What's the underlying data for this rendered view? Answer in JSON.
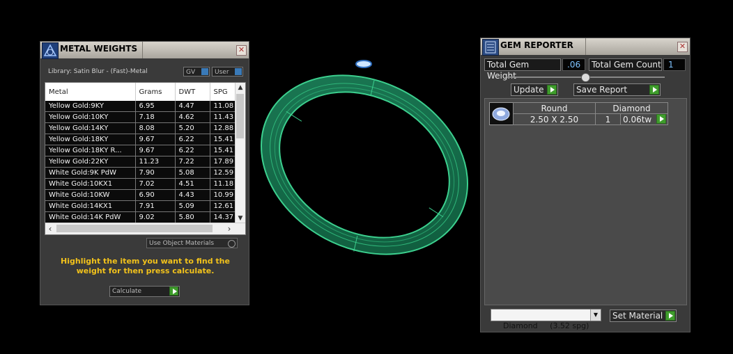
{
  "metal_weights": {
    "title": "METAL WEIGHTS",
    "library_label": "Library: Satin Blur - (Fast)-Metal",
    "gv_label": "GV",
    "user_label": "User",
    "columns": [
      "Metal",
      "Grams",
      "DWT",
      "SPG"
    ],
    "rows": [
      [
        "Yellow Gold:9KY",
        "6.95",
        "4.47",
        "11.08"
      ],
      [
        "Yellow Gold:10KY",
        "7.18",
        "4.62",
        "11.43"
      ],
      [
        "Yellow Gold:14KY",
        "8.08",
        "5.20",
        "12.88"
      ],
      [
        "Yellow Gold:18KY",
        "9.67",
        "6.22",
        "15.41"
      ],
      [
        "Yellow Gold:18KY R...",
        "9.67",
        "6.22",
        "15.41"
      ],
      [
        "Yellow Gold:22KY",
        "11.23",
        "7.22",
        "17.89"
      ],
      [
        "White Gold:9K PdW",
        "7.90",
        "5.08",
        "12.59"
      ],
      [
        "White Gold:10KX1",
        "7.02",
        "4.51",
        "11.18"
      ],
      [
        "White Gold:10KW",
        "6.90",
        "4.43",
        "10.99"
      ],
      [
        "White Gold:14KX1",
        "7.91",
        "5.09",
        "12.61"
      ],
      [
        "White Gold:14K PdW",
        "9.02",
        "5.80",
        "14.37"
      ]
    ],
    "use_object_materials": "Use Object Materials",
    "instruction": "Highlight the item you want to find the weight for then press calculate.",
    "calculate_label": "Calculate"
  },
  "gem_reporter": {
    "title": "GEM REPORTER",
    "total_weight_label": "Total Gem Weight",
    "total_weight_value": ".06",
    "total_count_label": "Total Gem Count",
    "total_count_value": "1",
    "update_label": "Update",
    "save_report_label": "Save Report",
    "gem": {
      "shape": "Round",
      "material": "Diamond",
      "size": "2.50 X 2.50",
      "count": "1",
      "weight": "0.06tw"
    },
    "material_select": "Diamond     (3.52 spg)",
    "set_material_label": "Set Material"
  },
  "colors": {
    "panel_bg": "#3a3a3a",
    "instruction_text": "#f2c21b",
    "value_text": "#7fc3ff",
    "ring_green": "#1e8a5c",
    "accent_green": "#3f9d2c"
  }
}
